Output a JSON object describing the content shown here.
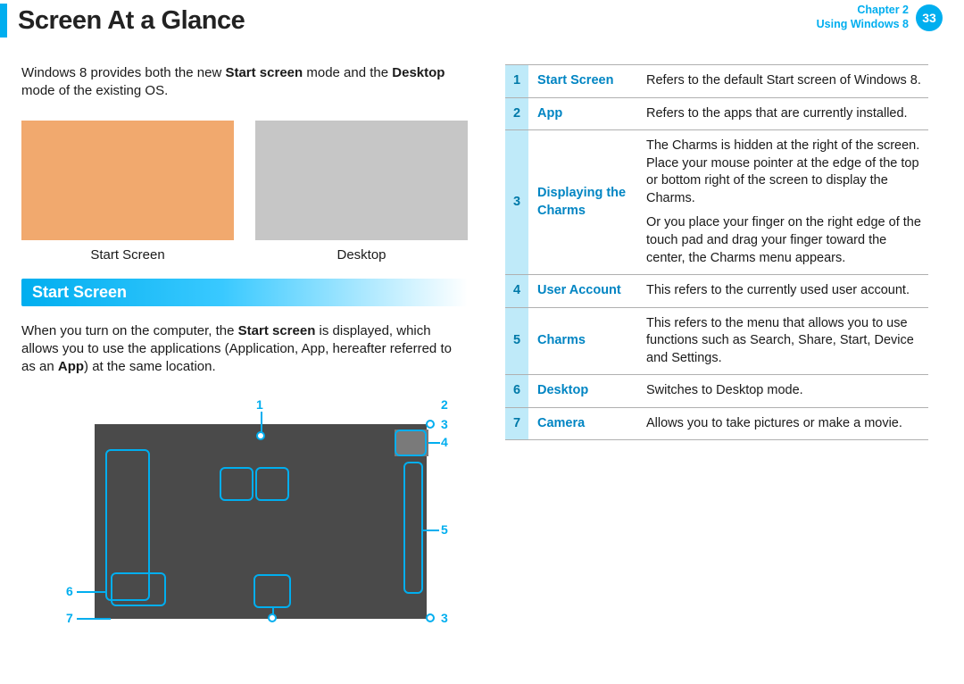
{
  "header": {
    "title": "Screen At a Glance",
    "chapter_line1": "Chapter 2",
    "chapter_line2": "Using Windows 8",
    "page_number": "33"
  },
  "intro": {
    "pre": "Windows 8 provides both the new ",
    "bold1": "Start screen",
    "mid": " mode and the ",
    "bold2": "Desktop",
    "post": " mode of the existing OS."
  },
  "modes": {
    "start_label": "Start Screen",
    "desktop_label": "Desktop"
  },
  "section": {
    "heading": "Start Screen",
    "body_pre": "When you turn on the computer, the ",
    "body_b1": "Start screen",
    "body_mid1": " is displayed, which allows you to use the applications (Application, App, hereafter referred to as an ",
    "body_b2": "App",
    "body_post": ") at the same location."
  },
  "callouts": {
    "n1": "1",
    "n2": "2",
    "n3": "3",
    "n4": "4",
    "n5": "5",
    "n6": "6",
    "n7": "7"
  },
  "table": [
    {
      "num": "1",
      "term": "Start Screen",
      "desc": "Refers to the default Start screen of Windows 8."
    },
    {
      "num": "2",
      "term": "App",
      "desc": "Refers to the apps that are currently installed."
    },
    {
      "num": "3",
      "term": "Displaying the Charms",
      "desc": "The Charms is hidden at the right of the screen. Place your mouse pointer at the edge of the top or bottom right of the screen to display the Charms.",
      "desc2": "Or you place your finger on the right edge of the touch pad and drag your finger toward the center, the Charms menu appears."
    },
    {
      "num": "4",
      "term": "User Account",
      "desc": "This refers to the currently used user account."
    },
    {
      "num": "5",
      "term": "Charms",
      "desc": "This refers to the menu that allows you to use functions such as Search, Share, Start, Device and Settings."
    },
    {
      "num": "6",
      "term": "Desktop",
      "desc": "Switches to Desktop mode."
    },
    {
      "num": "7",
      "term": "Camera",
      "desc": "Allows you to take pictures or make a movie."
    }
  ]
}
